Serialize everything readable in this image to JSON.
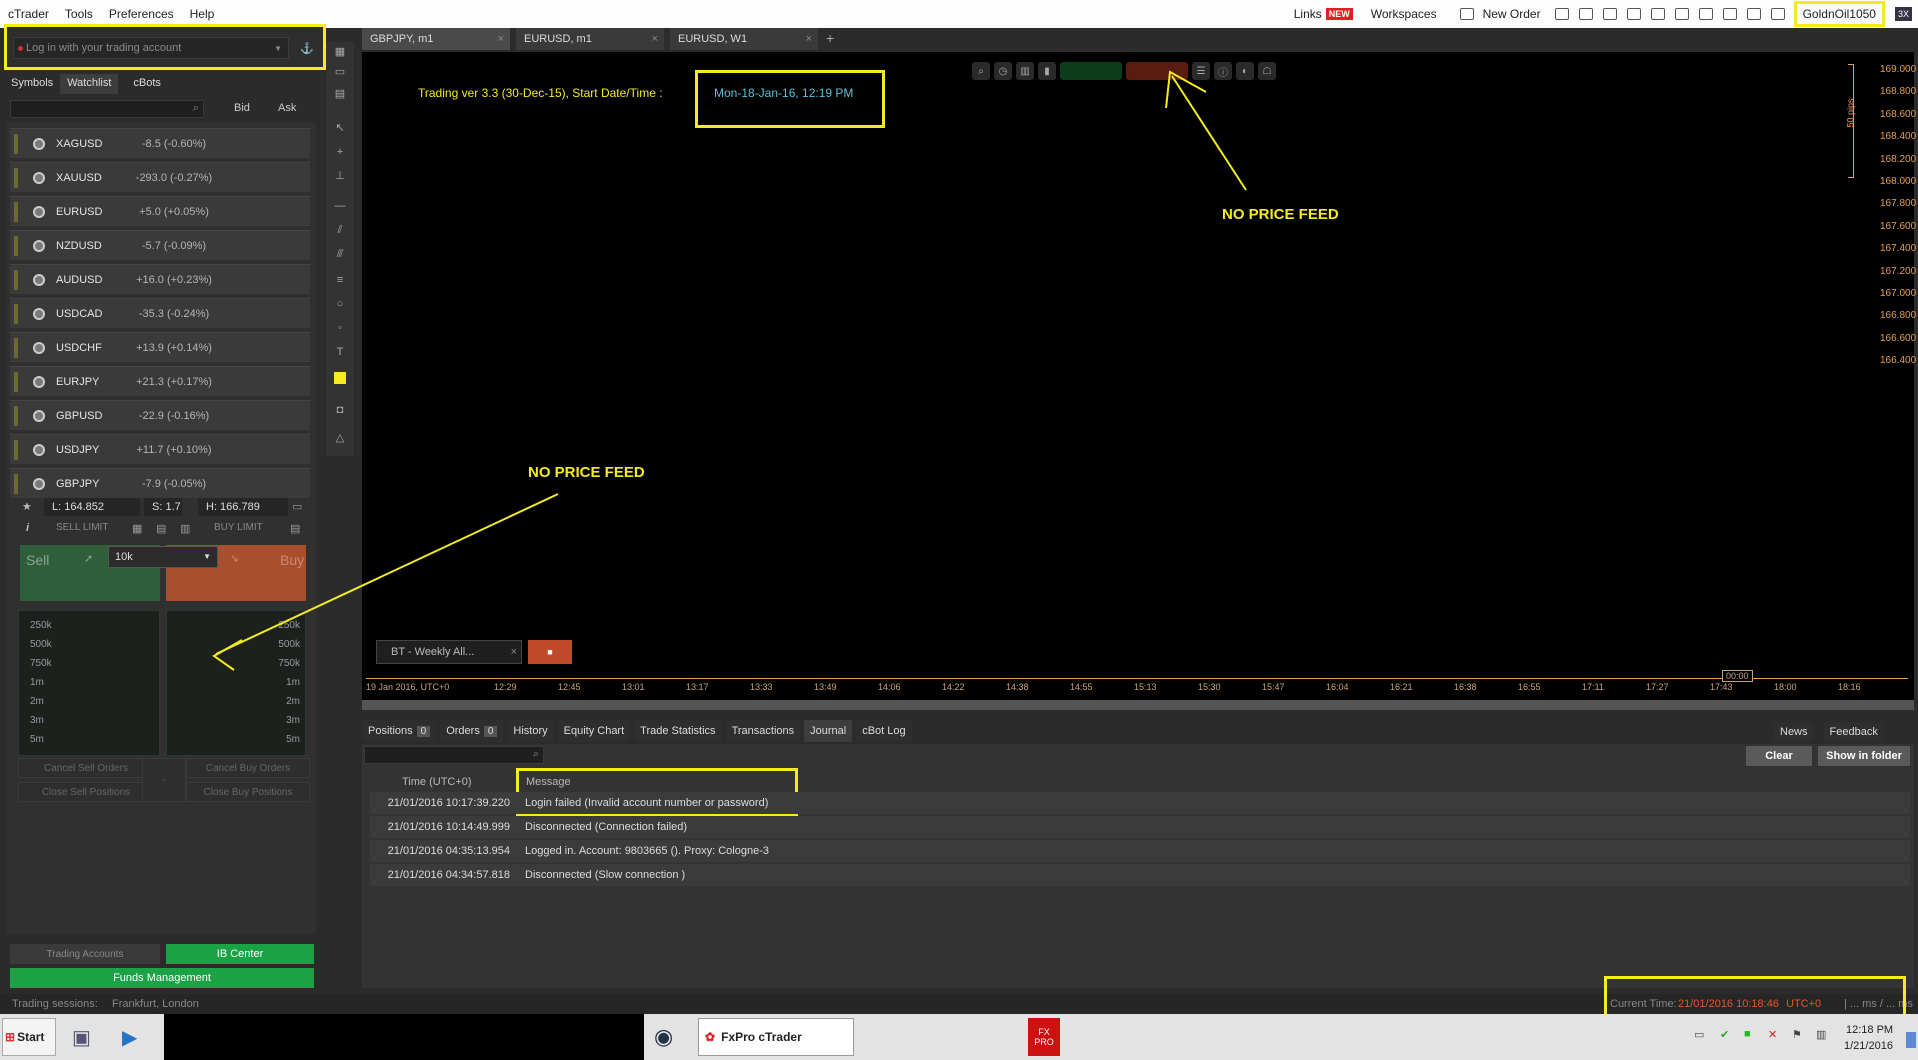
{
  "menubar": {
    "items": [
      "cTrader",
      "Tools",
      "Preferences",
      "Help"
    ],
    "links": "Links",
    "links_badge": "NEW",
    "workspaces": "Workspaces",
    "new_order": "New Order",
    "user": "GoldnOil1050",
    "xbtn": "3X"
  },
  "login": {
    "placeholder": "Log in with your trading account"
  },
  "left_tabs": [
    "Symbols",
    "Watchlist",
    "cBots"
  ],
  "watch_cols": {
    "bid": "Bid",
    "ask": "Ask"
  },
  "watchlist": [
    {
      "symbol": "XAGUSD",
      "change": "-8.5 (-0.60%)"
    },
    {
      "symbol": "XAUUSD",
      "change": "-293.0 (-0.27%)"
    },
    {
      "symbol": "EURUSD",
      "change": "+5.0 (+0.05%)"
    },
    {
      "symbol": "NZDUSD",
      "change": "-5.7 (-0.09%)"
    },
    {
      "symbol": "AUDUSD",
      "change": "+16.0 (+0.23%)"
    },
    {
      "symbol": "USDCAD",
      "change": "-35.3 (-0.24%)"
    },
    {
      "symbol": "USDCHF",
      "change": "+13.9 (+0.14%)"
    },
    {
      "symbol": "EURJPY",
      "change": "+21.3 (+0.17%)"
    },
    {
      "symbol": "GBPUSD",
      "change": "-22.9 (-0.16%)"
    },
    {
      "symbol": "USDJPY",
      "change": "+11.7 (+0.10%)"
    },
    {
      "symbol": "GBPJPY",
      "change": "-7.9 (-0.05%)"
    }
  ],
  "stats": {
    "low": "L: 164.852",
    "spread": "S: 1.7",
    "high": "H: 166.789"
  },
  "order": {
    "sell_limit": "SELL LIMIT",
    "buy_limit": "BUY LIMIT",
    "sell": "Sell",
    "buy": "Buy",
    "qty": "10k"
  },
  "depth": [
    "250k",
    "500k",
    "750k",
    "1m",
    "2m",
    "3m",
    "5m"
  ],
  "cancel": {
    "cancel_sell": "Cancel Sell Orders",
    "cancel_buy": "Cancel Buy Orders",
    "close_sell": "Close Sell Positions",
    "close_buy": "Close Buy Positions",
    "dash": "-"
  },
  "footer_btns": {
    "trading_accounts": "Trading Accounts",
    "ib_center": "IB Center",
    "funds": "Funds Management"
  },
  "chart_tabs": [
    "GBPJPY, m1",
    "EURUSD, m1",
    "EURUSD, W1"
  ],
  "chart": {
    "trading_text": "Trading ver 3.3 (30-Dec-15), Start Date/Time :",
    "start_date": "Mon-18-Jan-16,  12:19 PM",
    "pips": "50 pips",
    "no_feed_1": "NO PRICE FEED",
    "no_feed_2": "NO PRICE FEED",
    "bt": "BT - Weekly All...",
    "cursor_time": "00:00",
    "date_label": "19 Jan 2016, UTC+0",
    "y_labels": [
      "169.000",
      "168.800",
      "168.600",
      "168.400",
      "168.200",
      "168.000",
      "167.800",
      "167.600",
      "167.400",
      "167.200",
      "167.000",
      "166.800",
      "166.600",
      "166.400"
    ],
    "x_labels": [
      "12:29",
      "12:45",
      "13:01",
      "13:17",
      "13:33",
      "13:49",
      "14:06",
      "14:22",
      "14:38",
      "14:55",
      "15:13",
      "15:30",
      "15:47",
      "16:04",
      "16:21",
      "16:38",
      "16:55",
      "17:11",
      "17:27",
      "17:43",
      "18:00",
      "18:16"
    ]
  },
  "bottom_tabs": [
    {
      "label": "Positions",
      "count": "0"
    },
    {
      "label": "Orders",
      "count": "0"
    },
    {
      "label": "History"
    },
    {
      "label": "Equity Chart"
    },
    {
      "label": "Trade Statistics"
    },
    {
      "label": "Transactions"
    },
    {
      "label": "Journal"
    },
    {
      "label": "cBot Log"
    }
  ],
  "news": "News",
  "feedback": "Feedback",
  "journal": {
    "clear": "Clear",
    "show_folder": "Show in folder",
    "col_time": "Time (UTC+0)",
    "col_msg": "Message",
    "rows": [
      {
        "time": "21/01/2016 10:17:39.220",
        "msg": "Login failed (Invalid account number or password)"
      },
      {
        "time": "21/01/2016 10:14:49.999",
        "msg": "Disconnected (Connection failed)"
      },
      {
        "time": "21/01/2016 04:35:13.954",
        "msg": "Logged in. Account: 9803665 (). Proxy: Cologne-3"
      },
      {
        "time": "21/01/2016 04:34:57.818",
        "msg": "Disconnected (Slow connection )"
      }
    ]
  },
  "status": {
    "sessions_label": "Trading sessions:",
    "sessions": "Frankfurt, London",
    "current_time_label": "Current Time:",
    "current_time": "21/01/2016 10:18:46",
    "tz": "UTC+0",
    "ms": "| ... ms / ... ms"
  },
  "taskbar": {
    "start": "Start",
    "app": "FxPro cTrader",
    "time": "12:18 PM",
    "date": "1/21/2016",
    "fx": "FX PRO"
  }
}
